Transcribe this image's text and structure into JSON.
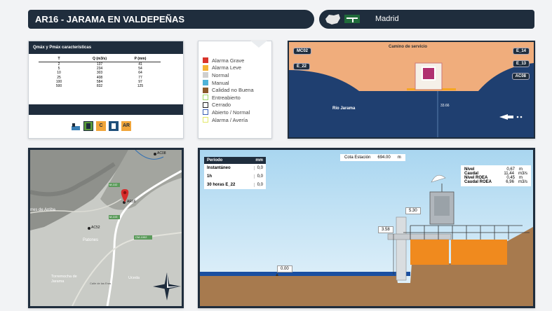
{
  "header": {
    "title": "AR16 - JARAMA EN VALDEPEÑAS",
    "region": "Madrid"
  },
  "qmax": {
    "title": "Qmáx y Pmáx características",
    "columns": [
      "T",
      "Q (m3/s)",
      "P (mm)"
    ],
    "rows": [
      [
        "2",
        "137",
        "41"
      ],
      [
        "5",
        "234",
        "54"
      ],
      [
        "10",
        "303",
        "64"
      ],
      [
        "25",
        "408",
        "77"
      ],
      [
        "100",
        "584",
        "97"
      ],
      [
        "500",
        "832",
        "125"
      ]
    ],
    "icons": [
      {
        "name": "station-icon",
        "label": ""
      },
      {
        "name": "gauge-icon",
        "label": ""
      },
      {
        "name": "c-badge",
        "label": "C"
      },
      {
        "name": "tower-icon",
        "label": ""
      },
      {
        "name": "ar-badge",
        "label": "AR"
      }
    ]
  },
  "legend": {
    "items": [
      {
        "label": "Alarma Grave",
        "color": "#d9342b",
        "style": "fill"
      },
      {
        "label": "Alarma Leve",
        "color": "#f5b335",
        "style": "fill"
      },
      {
        "label": "Normal",
        "color": "#cfcfcf",
        "style": "fill"
      },
      {
        "label": "Manual",
        "color": "#4fb3d9",
        "style": "fill"
      },
      {
        "label": "Calidad no Buena",
        "color": "#8a5a2b",
        "style": "fill"
      },
      {
        "label": "Entreabierto",
        "color": "#9fd96a",
        "style": "outline"
      },
      {
        "label": "Cerrado",
        "color": "#222222",
        "style": "outline"
      },
      {
        "label": "Abierto / Normal",
        "color": "#3b5fb5",
        "style": "outline"
      },
      {
        "label": "Alarma / Avería",
        "color": "#e3e86a",
        "style": "outline"
      }
    ]
  },
  "section": {
    "road_label": "Camino de servicio",
    "tags_left": [
      "MC02",
      "E_22"
    ],
    "tags_right": [
      "E_14",
      "E_13",
      "AC08"
    ],
    "river_label": "Río Jarama",
    "level": "33.66"
  },
  "map": {
    "labels": {
      "ac08": "AC08",
      "ar16": "AR16",
      "ac52": "AC52",
      "town1": "rres de Arriba",
      "town2": "Patones",
      "town3": "Torremocha de Jarama",
      "town4": "Uceda",
      "road1": "M-102",
      "road2": "M-103",
      "road3": "CM-1002",
      "street": "Calle de las Eras"
    }
  },
  "station": {
    "period_header": "Período",
    "period_unit": "mm",
    "periods": [
      {
        "label": "Instantáneo",
        "value": "0,0"
      },
      {
        "label": "1h",
        "value": "0,0"
      },
      {
        "label": "30 horas E_22",
        "value": "0,0"
      }
    ],
    "cota_label": "Cota Estación",
    "cota_value": "694.00",
    "cota_unit": "m",
    "readings": [
      {
        "label": "Nivel",
        "value": "0,67",
        "unit": "m"
      },
      {
        "label": "Caudal",
        "value": "11,44",
        "unit": "m3/s"
      },
      {
        "label": "Nivel ROEA",
        "value": "0,45",
        "unit": "m"
      },
      {
        "label": "Caudal ROEA",
        "value": "6,96",
        "unit": "m3/s"
      }
    ],
    "levels": {
      "top": "5.30",
      "mid": "3.58",
      "bottom": "0.00"
    }
  }
}
